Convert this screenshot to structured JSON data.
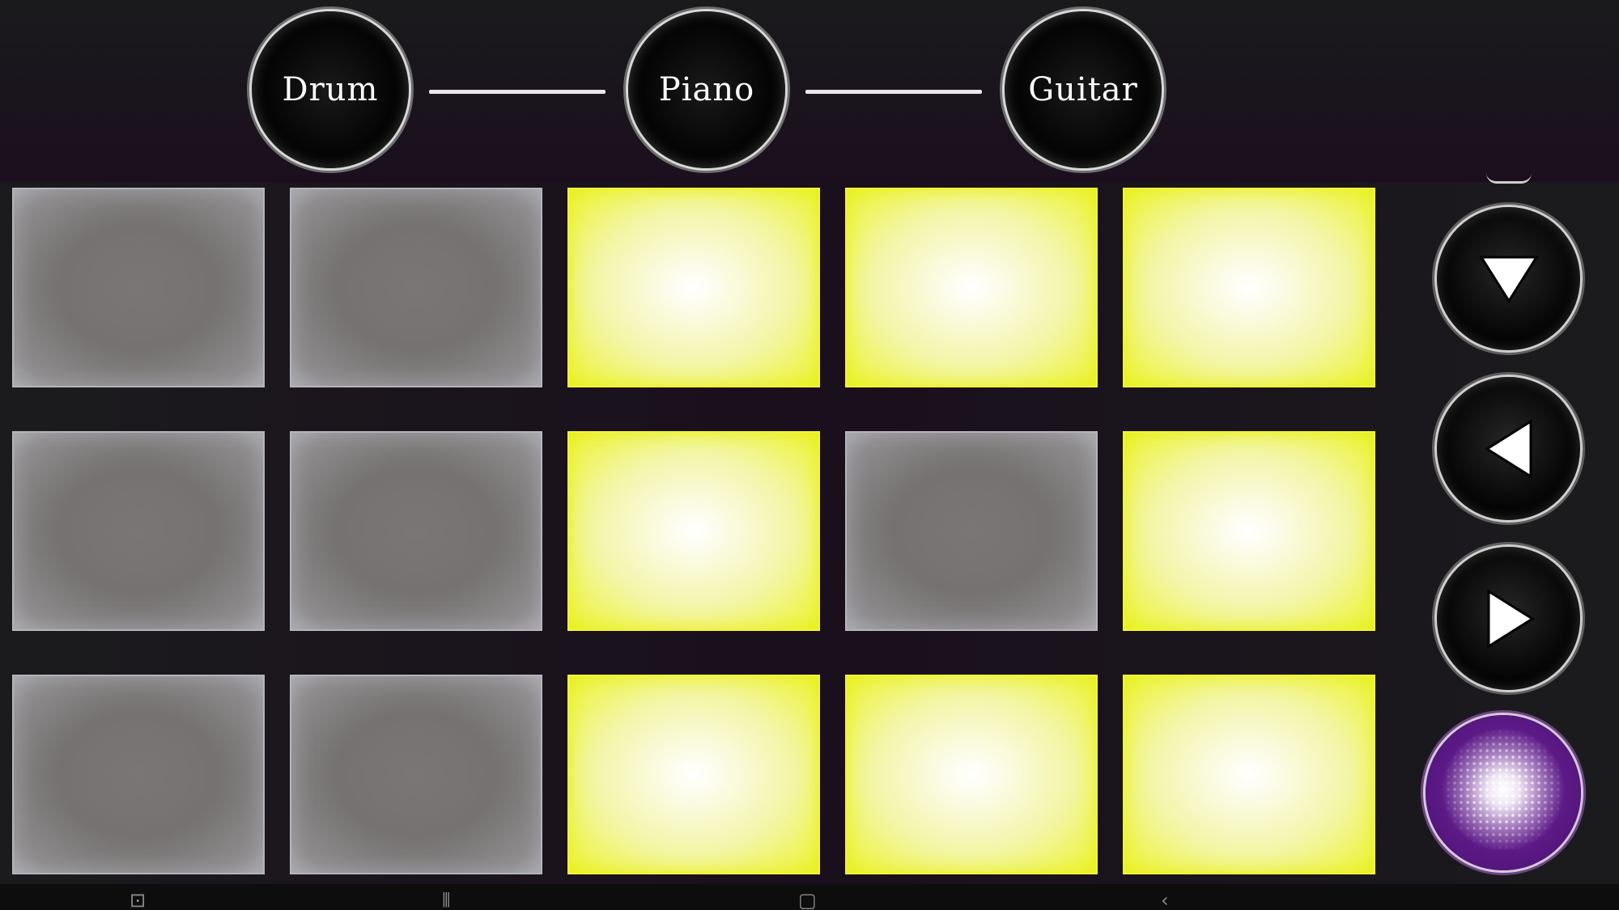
{
  "instruments": {
    "drum_label": "Drum",
    "piano_label": "Piano",
    "guitar_label": "Guitar"
  },
  "pads": {
    "rows": [
      [
        "off",
        "off",
        "on",
        "on",
        "on"
      ],
      [
        "off",
        "off",
        "on",
        "off",
        "on"
      ],
      [
        "off",
        "off",
        "on",
        "on",
        "on"
      ]
    ]
  },
  "controls": {
    "icons": [
      "down-triangle-icon",
      "left-triangle-icon",
      "right-triangle-icon",
      "record-icon"
    ]
  },
  "system_bar": {
    "icons": [
      "screenshot-icon",
      "recent-apps-icon",
      "home-icon",
      "back-icon"
    ]
  },
  "colors": {
    "pad_on": "#eef447",
    "pad_off": "#757271",
    "record": "#5c1a86",
    "background": "#1a0f1c"
  }
}
